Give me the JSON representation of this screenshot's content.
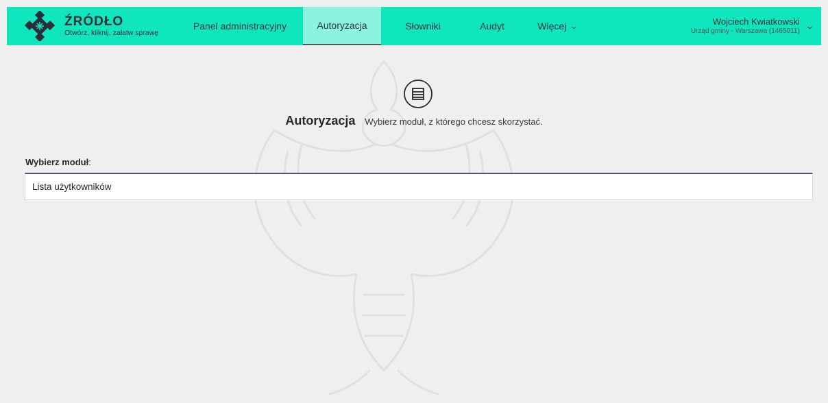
{
  "header": {
    "brand_name": "ŹRÓDŁO",
    "brand_tagline": "Otwórz, kliknij, załatw sprawę",
    "nav": [
      {
        "label": "Panel administracyjny",
        "active": false
      },
      {
        "label": "Autoryzacja",
        "active": true
      },
      {
        "label": "Słowniki",
        "active": false
      },
      {
        "label": "Audyt",
        "active": false
      },
      {
        "label": "Więcej",
        "active": false
      }
    ],
    "user_name": "Wojciech Kwiatkowski",
    "user_org": "Urząd gminy - Warszawa (1465011)"
  },
  "page": {
    "title": "Autoryzacja",
    "description": "Wybierz moduł, z którego chcesz skorzystać."
  },
  "module_select": {
    "label": "Wybierz moduł",
    "label_suffix": ":",
    "selected": "Lista użytkowników"
  },
  "colors": {
    "topbar": "#10e6bd",
    "active_tab": "#8bf3dd",
    "background": "#efefef",
    "select_accent": "#5a4a8a"
  },
  "icons": {
    "logo": "zrodlo-logo-icon",
    "heading": "list-circle-icon",
    "chevron": "chevron-down-icon"
  }
}
